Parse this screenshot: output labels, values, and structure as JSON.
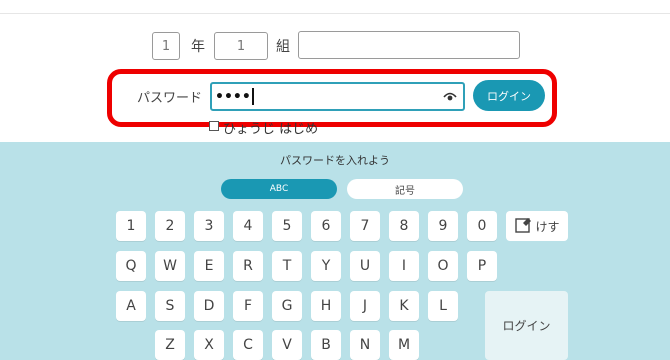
{
  "form": {
    "grade_value": "1",
    "grade_unit": "年",
    "class_value": "1",
    "class_unit": "組",
    "name_value": ""
  },
  "password": {
    "label": "パスワード",
    "masked_value": "••••",
    "login_button": "ログイン"
  },
  "options": {
    "checkbox_row_text": "ひょうじ はじめ"
  },
  "keyboard": {
    "prompt": "パスワードを入れよう",
    "tabs": [
      "ABC",
      "記号"
    ],
    "active_tab": "ABC",
    "rows": [
      [
        "1",
        "2",
        "3",
        "4",
        "5",
        "6",
        "7",
        "8",
        "9",
        "0"
      ],
      [
        "Q",
        "W",
        "E",
        "R",
        "T",
        "Y",
        "U",
        "I",
        "O",
        "P"
      ],
      [
        "A",
        "S",
        "D",
        "F",
        "G",
        "H",
        "J",
        "K",
        "L"
      ],
      [
        "Z",
        "X",
        "C",
        "V",
        "B",
        "N",
        "M"
      ]
    ],
    "erase_label": "けす",
    "login_label": "ログイン"
  },
  "colors": {
    "accent": "#1a98b3",
    "panel_bg": "#b9e1e8",
    "highlight": "#ee0000"
  },
  "icons": [
    "eye-icon",
    "erase-icon"
  ]
}
